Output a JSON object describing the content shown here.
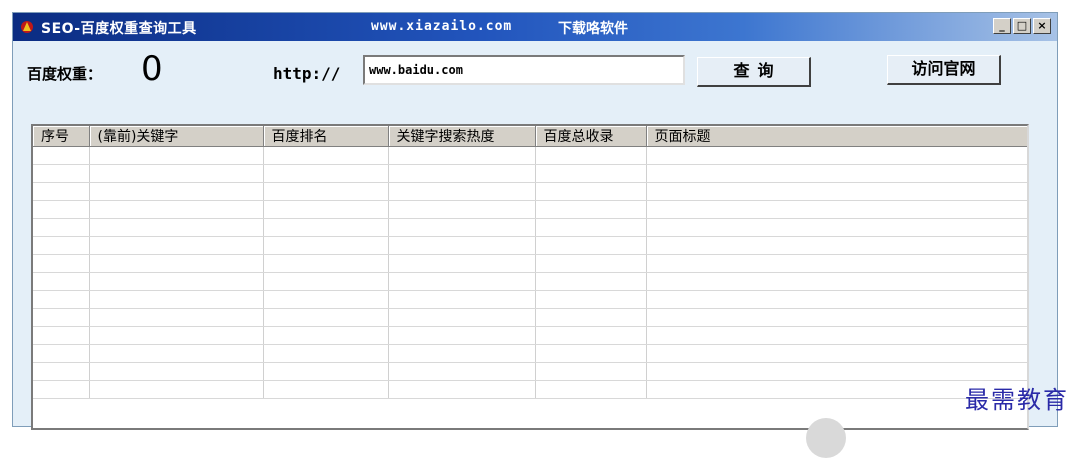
{
  "window": {
    "title": "SEO-百度权重查询工具",
    "title_url": "www.xiazailo.com",
    "title_site": "下载咯软件",
    "controls": {
      "minimize": "_",
      "maximize": "□",
      "close": "×"
    }
  },
  "form": {
    "weight_label": "百度权重：",
    "weight_value": "0",
    "http_label": "http://",
    "url_value": "www.baidu.com",
    "query_button": "查询",
    "visit_button": "访问官网"
  },
  "table": {
    "columns": [
      "序号",
      "(靠前)关键字",
      "百度排名",
      "关键字搜索热度",
      "百度总收录",
      "页面标题"
    ],
    "empty_rows": 14
  },
  "watermark": "最需教育",
  "colors": {
    "title_start": "#0b2c82",
    "window_bg": "#e4eff8",
    "header_bg": "#d4d0c8"
  }
}
